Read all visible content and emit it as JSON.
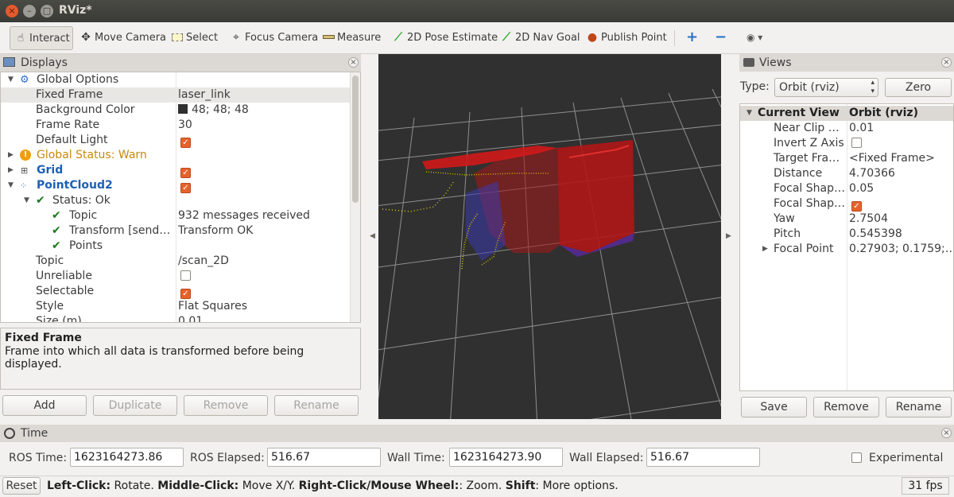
{
  "window": {
    "title": "RViz*",
    "close_glyph": "×",
    "min_glyph": "–",
    "max_glyph": "□"
  },
  "toolbar": {
    "interact": "Interact",
    "move_camera": "Move Camera",
    "select": "Select",
    "focus_camera": "Focus Camera",
    "measure": "Measure",
    "pose_estimate": "2D Pose Estimate",
    "nav_goal": "2D Nav Goal",
    "publish_point": "Publish Point",
    "plus_glyph": "+",
    "minus_glyph": "−",
    "eye_glyph": "◉ ▾",
    "icons": {
      "interact": "hand-pointer-icon",
      "move_camera": "move-camera-icon",
      "select": "select-rectangle-icon",
      "focus_camera": "focus-crosshair-icon",
      "measure": "ruler-icon",
      "pose": "green-arrow-icon",
      "nav": "green-arrow-icon",
      "publish": "map-pin-icon"
    }
  },
  "displays": {
    "title": "Displays",
    "rows": [
      {
        "label": "Global Options",
        "value": ""
      },
      {
        "label": "Fixed Frame",
        "value": "laser_link"
      },
      {
        "label": "Background Color",
        "value": "48; 48; 48"
      },
      {
        "label": "Frame Rate",
        "value": "30"
      },
      {
        "label": "Default Light",
        "value": ""
      },
      {
        "label": "Global Status: Warn",
        "value": ""
      },
      {
        "label": "Grid",
        "value": ""
      },
      {
        "label": "PointCloud2",
        "value": ""
      },
      {
        "label": "Status: Ok",
        "value": ""
      },
      {
        "label": "Topic",
        "value": "932 messages received"
      },
      {
        "label": "Transform [send…",
        "value": "Transform OK"
      },
      {
        "label": "Points",
        "value": ""
      },
      {
        "label": "Topic",
        "value": "/scan_2D"
      },
      {
        "label": "Unreliable",
        "value": ""
      },
      {
        "label": "Selectable",
        "value": ""
      },
      {
        "label": "Style",
        "value": "Flat Squares"
      },
      {
        "label": "Size (m)",
        "value": "0.01"
      }
    ],
    "description_title": "Fixed Frame",
    "description_text": "Frame into which all data is transformed before being displayed.",
    "buttons": {
      "add": "Add",
      "duplicate": "Duplicate",
      "remove": "Remove",
      "rename": "Rename"
    },
    "colors": {
      "warn": "#c8890a",
      "link": "#1c61b5",
      "ok": "#1a7a1a",
      "background_swatch": "#303030"
    }
  },
  "views": {
    "title": "Views",
    "type_label": "Type:",
    "type_value": "Orbit (rviz)",
    "zero_button": "Zero",
    "rows": [
      {
        "label": "Current View",
        "value": "Orbit (rviz)"
      },
      {
        "label": "Near Clip …",
        "value": "0.01"
      },
      {
        "label": "Invert Z Axis",
        "value": ""
      },
      {
        "label": "Target Fra…",
        "value": "<Fixed Frame>"
      },
      {
        "label": "Distance",
        "value": "4.70366"
      },
      {
        "label": "Focal Shap…",
        "value": "0.05"
      },
      {
        "label": "Focal Shap…",
        "value": ""
      },
      {
        "label": "Yaw",
        "value": "2.7504"
      },
      {
        "label": "Pitch",
        "value": "0.545398"
      },
      {
        "label": "Focal Point",
        "value": "0.27903; 0.1759;…"
      }
    ],
    "buttons": {
      "save": "Save",
      "remove": "Remove",
      "rename": "Rename"
    }
  },
  "time": {
    "title": "Time",
    "ros_time_label": "ROS Time:",
    "ros_time": "1623164273.86",
    "ros_elapsed_label": "ROS Elapsed:",
    "ros_elapsed": "516.67",
    "wall_time_label": "Wall Time:",
    "wall_time": "1623164273.90",
    "wall_elapsed_label": "Wall Elapsed:",
    "wall_elapsed": "516.67",
    "experimental_label": "Experimental"
  },
  "statusbar": {
    "reset": "Reset",
    "left_click_label": "Left-Click:",
    "left_click_text": " Rotate. ",
    "middle_click_label": "Middle-Click:",
    "middle_click_text": " Move X/Y. ",
    "right_click_label": "Right-Click/Mouse Wheel:",
    "right_click_text": ": Zoom. ",
    "shift_label": "Shift",
    "shift_text": ": More options.",
    "fps": "31 fps"
  },
  "viewport": {
    "background": "#303030",
    "grid_color": "#a0a0a0"
  }
}
